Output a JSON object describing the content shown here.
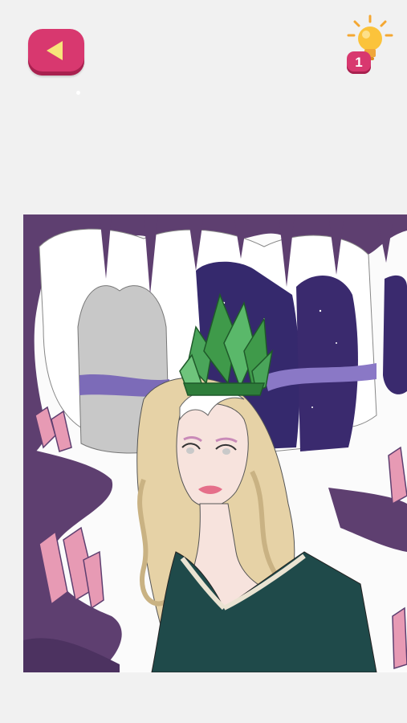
{
  "hint": {
    "count": "1"
  },
  "colors": {
    "accent": "#d8386f",
    "cave_purple": "#5e3f70",
    "night_sky": "#3a2a6e",
    "crystal_green": "#3f9a4a",
    "crystal_pink": "#e79ab4",
    "hair": "#e6d2a6",
    "dress": "#1f4a4a"
  }
}
